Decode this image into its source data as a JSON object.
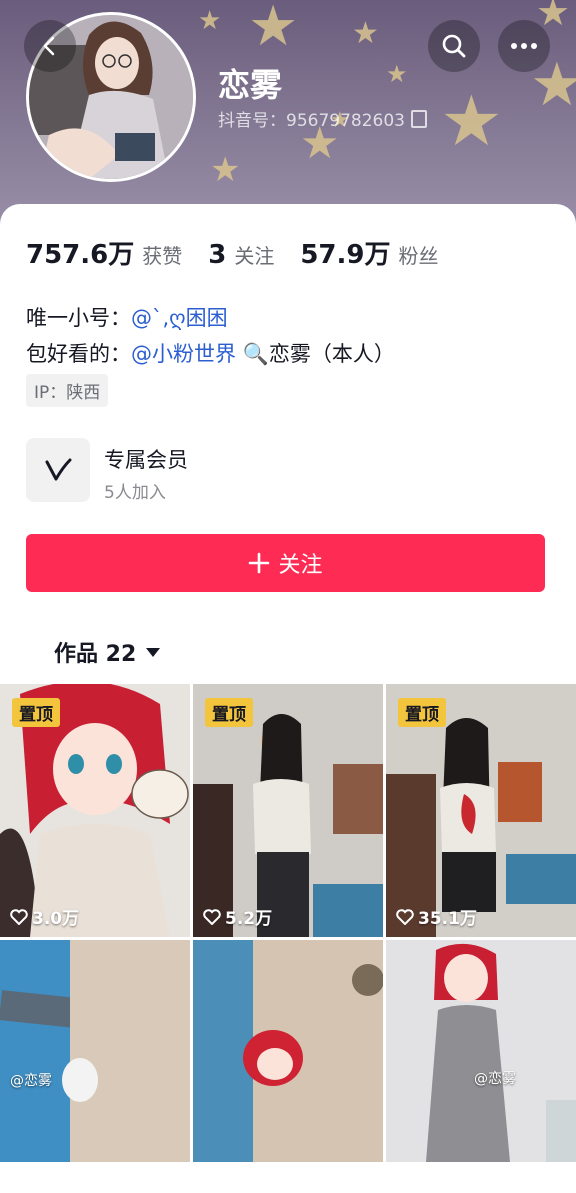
{
  "profile": {
    "name": "恋雾",
    "douyin_id": "抖音号：95679782603"
  },
  "stats": [
    {
      "value": "757.6万",
      "label": "获赞"
    },
    {
      "value": "3",
      "label": "关注"
    },
    {
      "value": "57.9万",
      "label": "粉丝"
    }
  ],
  "bio": {
    "line1_prefix": "唯一小号：",
    "line1_link": "@`,ღ困困",
    "line2_prefix": "包好看的：",
    "line2_link": "@小粉世界",
    "line2_suffix": "🔍恋雾（本人）",
    "ip": "IP：陕西"
  },
  "membership": {
    "title": "专属会员",
    "subtitle": "5人加入"
  },
  "follow_button": {
    "label": "关注"
  },
  "works_tab": {
    "label": "作品 22"
  },
  "videos": [
    {
      "pinned": "置顶",
      "likes": "3.0万"
    },
    {
      "pinned": "置顶",
      "likes": "5.2万"
    },
    {
      "pinned": "置顶",
      "likes": "35.1万"
    },
    {
      "watermark": "@恋雾"
    },
    {},
    {
      "watermark": "@恋雾"
    }
  ],
  "colors": {
    "accent": "#fe2c55",
    "pin": "#f3c53c",
    "link": "#2b5fd1"
  },
  "icons": [
    "back-icon",
    "search-icon",
    "more-icon",
    "copy-icon",
    "vip-v-icon",
    "plus-icon",
    "heart-icon",
    "dropdown-icon"
  ]
}
